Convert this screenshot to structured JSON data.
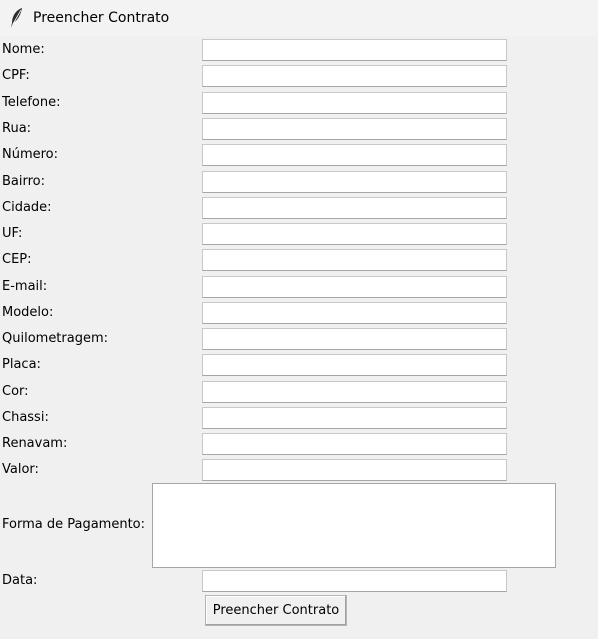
{
  "window": {
    "title": "Preencher Contrato",
    "icon": "feather-icon"
  },
  "form": {
    "fields": [
      {
        "label": "Nome:",
        "value": ""
      },
      {
        "label": "CPF:",
        "value": ""
      },
      {
        "label": "Telefone:",
        "value": ""
      },
      {
        "label": "Rua:",
        "value": ""
      },
      {
        "label": "Número:",
        "value": ""
      },
      {
        "label": "Bairro:",
        "value": ""
      },
      {
        "label": "Cidade:",
        "value": ""
      },
      {
        "label": "UF:",
        "value": ""
      },
      {
        "label": "CEP:",
        "value": ""
      },
      {
        "label": "E-mail:",
        "value": ""
      },
      {
        "label": "Modelo:",
        "value": ""
      },
      {
        "label": "Quilometragem:",
        "value": ""
      },
      {
        "label": "Placa:",
        "value": ""
      },
      {
        "label": "Cor:",
        "value": ""
      },
      {
        "label": "Chassi:",
        "value": ""
      },
      {
        "label": "Renavam:",
        "value": ""
      },
      {
        "label": "Valor:",
        "value": ""
      }
    ],
    "payment": {
      "label": "Forma de Pagamento:",
      "value": ""
    },
    "date": {
      "label": "Data:",
      "value": ""
    },
    "submit_label": "Preencher Contrato"
  }
}
